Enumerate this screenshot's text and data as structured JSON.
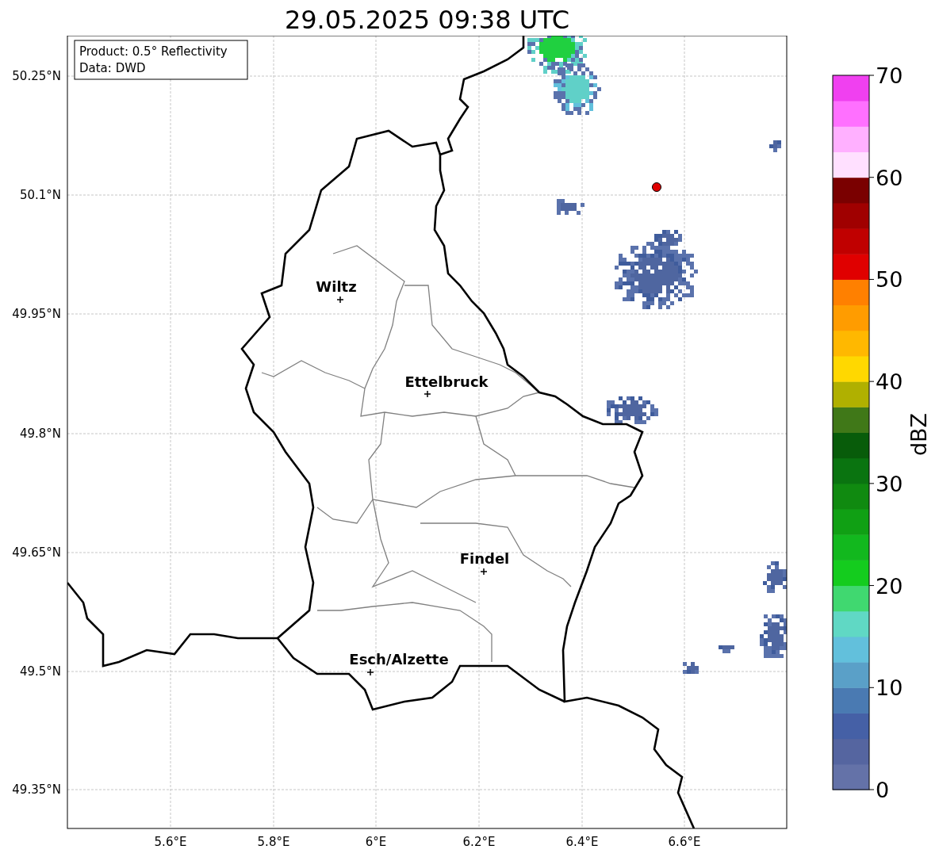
{
  "title": "29.05.2025 09:38 UTC",
  "info_box": {
    "lines": [
      "Product: 0.5° Reflectivity",
      "Data: DWD"
    ]
  },
  "map": {
    "x_ticks": [
      "5.6°E",
      "5.8°E",
      "6°E",
      "6.2°E",
      "6.4°E",
      "6.6°E"
    ],
    "y_ticks": [
      "50.25°N",
      "50.1°N",
      "49.95°N",
      "49.8°N",
      "49.65°N",
      "49.5°N",
      "49.35°N"
    ],
    "cities": [
      {
        "name": "Wiltz"
      },
      {
        "name": "Ettelbruck"
      },
      {
        "name": "Findel"
      },
      {
        "name": "Esch/Alzette"
      }
    ]
  },
  "colorbar": {
    "label": "dBZ",
    "ticks": [
      "70",
      "60",
      "50",
      "40",
      "30",
      "20",
      "10",
      "0"
    ],
    "segments": [
      {
        "color": "#6472a8"
      },
      {
        "color": "#5565a0"
      },
      {
        "color": "#4560a6"
      },
      {
        "color": "#4a7ab2"
      },
      {
        "color": "#5aa0c8"
      },
      {
        "color": "#62c0dc"
      },
      {
        "color": "#60d8c4"
      },
      {
        "color": "#40d870"
      },
      {
        "color": "#14cc1e"
      },
      {
        "color": "#12b81e"
      },
      {
        "color": "#10a014"
      },
      {
        "color": "#108a10"
      },
      {
        "color": "#0a7410"
      },
      {
        "color": "#085c0a"
      },
      {
        "color": "#407818"
      },
      {
        "color": "#b0b000"
      },
      {
        "color": "#ffd800"
      },
      {
        "color": "#ffb800"
      },
      {
        "color": "#ff9c00"
      },
      {
        "color": "#ff8000"
      },
      {
        "color": "#e00000"
      },
      {
        "color": "#c00000"
      },
      {
        "color": "#a00000"
      },
      {
        "color": "#7a0000"
      },
      {
        "color": "#ffe0ff"
      },
      {
        "color": "#ffb0ff"
      },
      {
        "color": "#ff70ff"
      },
      {
        "color": "#f040f0"
      }
    ]
  }
}
